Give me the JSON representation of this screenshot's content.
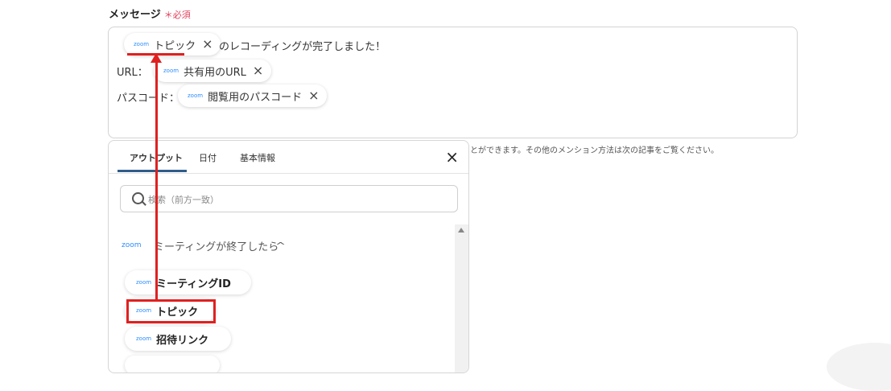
{
  "field": {
    "label": "メッセージ",
    "required": "＊必須"
  },
  "editor": {
    "line1": {
      "chip": {
        "icon_text": "zoom",
        "label": "トピック",
        "close": "×"
      },
      "text": "のレコーディングが完了しました！"
    },
    "line2": {
      "prefix": "URL：",
      "chip": {
        "icon_text": "zoom",
        "label": "共有用のURL",
        "close": "×"
      }
    },
    "line3": {
      "prefix": "パスコード：",
      "chip": {
        "icon_text": "zoom",
        "label": "閲覧用のパスコード",
        "close": "×"
      }
    }
  },
  "help_text": "とができます。その他のメンション方法は次の記事をご覧ください。",
  "panel": {
    "tabs": [
      "アウトプット",
      "日付",
      "基本情報"
    ],
    "active_tab": 0,
    "close": "×",
    "search_placeholder": "検索（前方一致）",
    "section": {
      "icon_text": "zoom",
      "title": "ミーティングが終了したら",
      "chevron": "^"
    },
    "items": [
      {
        "icon_text": "zoom",
        "label": "ミーティングID"
      },
      {
        "icon_text": "zoom",
        "label": "トピック"
      },
      {
        "icon_text": "zoom",
        "label": "招待リンク"
      }
    ]
  },
  "colors": {
    "annotation": "#e02020",
    "zoom": "#2d8cff",
    "required": "#e0405a"
  }
}
